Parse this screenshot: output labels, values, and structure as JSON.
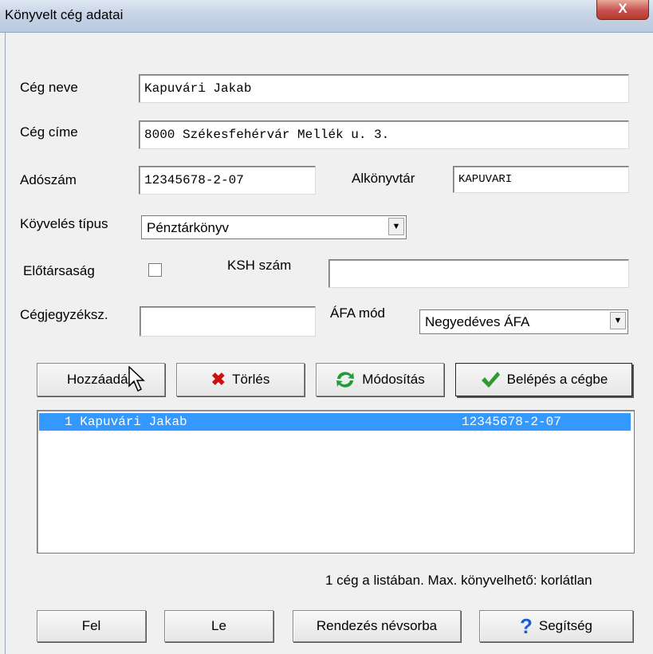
{
  "window": {
    "title": "Könyvelt cég adatai",
    "close_label": "X"
  },
  "form": {
    "company_name_label": "Cég neve",
    "company_name_value": "Kapuvári Jakab",
    "company_address_label": "Cég címe",
    "company_address_value": "8000 Székesfehérvár Mellék u. 3.",
    "tax_number_label": "Adószám",
    "tax_number_value": "12345678-2-07",
    "subdirectory_label": "Alkönyvtár",
    "subdirectory_value": "KAPUVARI",
    "bookkeeping_type_label": "Köyvelés típus",
    "bookkeeping_type_value": "Pénztárkönyv",
    "pre_company_label": "Előtársaság",
    "pre_company_checked": false,
    "ksh_label": "KSH szám",
    "ksh_value": "",
    "registry_label": "Cégjegyzéksz.",
    "registry_value": "",
    "vat_mode_label": "ÁFA mód",
    "vat_mode_value": "Negyedéves ÁFA"
  },
  "actions": {
    "add_label": "Hozzáadás",
    "delete_label": "Törlés",
    "modify_label": "Módosítás",
    "enter_label": "Belépés a cégbe"
  },
  "list": {
    "items": [
      {
        "number": "1",
        "name": "Kapuvári Jakab",
        "tax": "12345678-2-07",
        "selected": true
      }
    ],
    "status": "1 cég a listában. Max. könyvelhető: korlátlan"
  },
  "bottom": {
    "up_label": "Fel",
    "down_label": "Le",
    "sort_label": "Rendezés névsorba",
    "help_label": "Segítség"
  },
  "colors": {
    "selection": "#3399ff",
    "delete_icon": "#cc1111",
    "refresh_icon": "#1e9e3a",
    "check_icon": "#2f9a2f",
    "help_icon": "#1a5fd0"
  }
}
